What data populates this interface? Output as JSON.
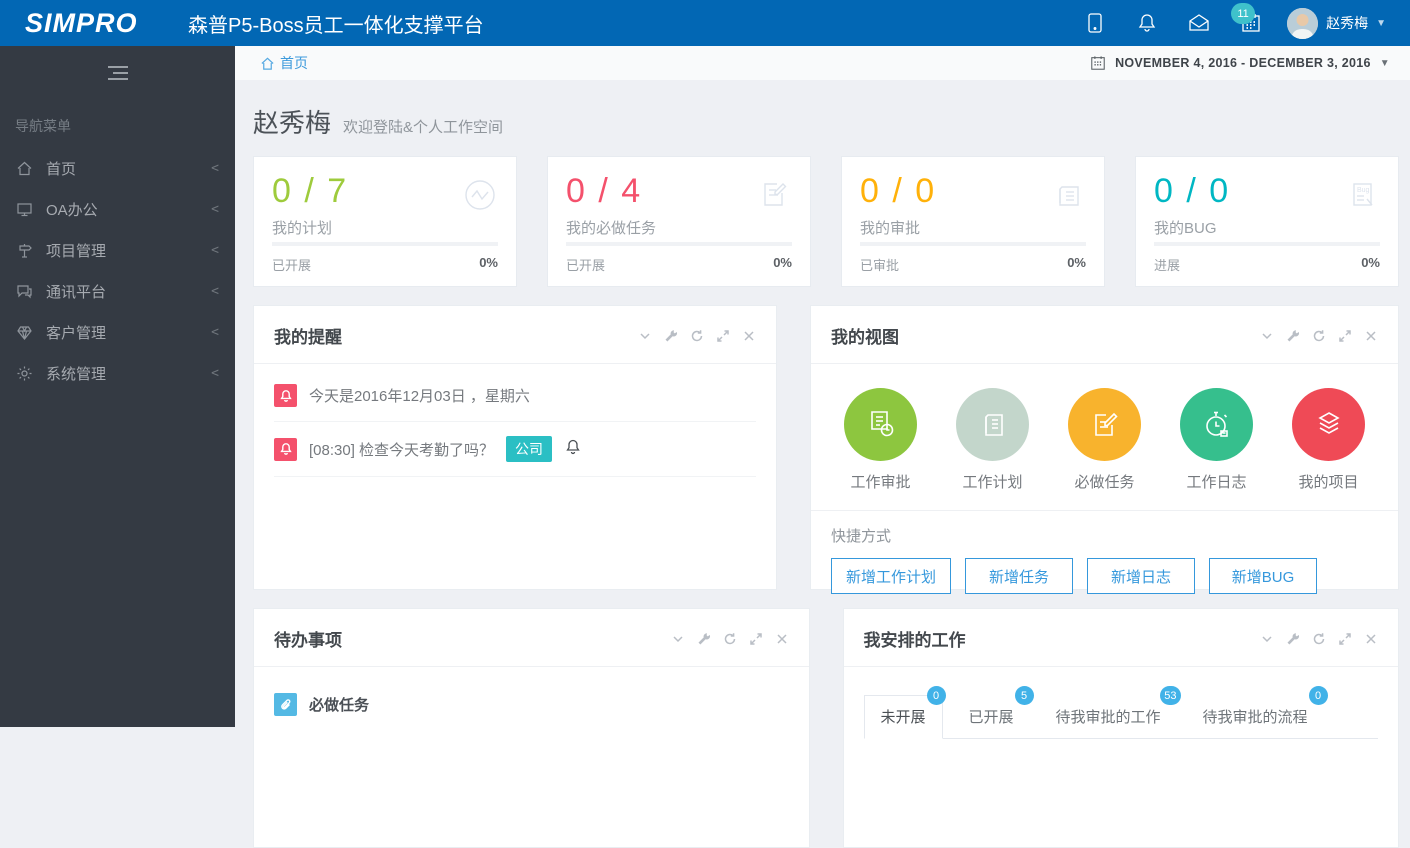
{
  "header": {
    "logo": "SIMPRO",
    "title": "森普P5-Boss员工一体化支撑平台",
    "calendar_badge": "11",
    "user_name": "赵秀梅"
  },
  "sidebar": {
    "section_label": "导航菜单",
    "items": [
      {
        "label": "首页",
        "icon": "home-icon"
      },
      {
        "label": "OA办公",
        "icon": "monitor-icon"
      },
      {
        "label": "项目管理",
        "icon": "signpost-icon"
      },
      {
        "label": "通讯平台",
        "icon": "chat-icon"
      },
      {
        "label": "客户管理",
        "icon": "gem-icon"
      },
      {
        "label": "系统管理",
        "icon": "gear-icon"
      }
    ]
  },
  "breadcrumb": {
    "home": "首页"
  },
  "daterange": {
    "value": "NOVEMBER 4, 2016 - DECEMBER 3, 2016"
  },
  "welcome": {
    "name": "赵秀梅",
    "subtitle": "欢迎登陆&个人工作空间"
  },
  "stats": [
    {
      "value": "0 / 7",
      "label": "我的计划",
      "footer_label": "已开展",
      "percent": "0%",
      "progress": 0,
      "color": "#9ecb3c",
      "icon": "pulse-circle-icon"
    },
    {
      "value": "0 / 4",
      "label": "我的必做任务",
      "footer_label": "已开展",
      "percent": "0%",
      "progress": 0,
      "color": "#f4516c",
      "icon": "edit-note-icon"
    },
    {
      "value": "0 / 0",
      "label": "我的审批",
      "footer_label": "已审批",
      "percent": "0%",
      "progress": 0,
      "color": "#ffb10a",
      "icon": "news-doc-icon"
    },
    {
      "value": "0 / 0",
      "label": "我的BUG",
      "footer_label": "进展",
      "percent": "0%",
      "progress": 0,
      "color": "#00b7c3",
      "icon": "bug-doc-icon"
    }
  ],
  "reminders_panel": {
    "title": "我的提醒",
    "items": [
      {
        "text": "今天是2016年12月03日 ，星期六",
        "badge": ""
      },
      {
        "text": "[08:30] 检查今天考勤了吗？",
        "badge": "公司"
      }
    ]
  },
  "views_panel": {
    "title": "我的视图",
    "items": [
      {
        "label": "工作审批",
        "color": "#8dc63f",
        "icon": "doc-clock-icon"
      },
      {
        "label": "工作计划",
        "color": "#c3d6cb",
        "icon": "doc-lines-icon"
      },
      {
        "label": "必做任务",
        "color": "#f8b32d",
        "icon": "edit-square-icon"
      },
      {
        "label": "工作日志",
        "color": "#36bf8d",
        "icon": "stopwatch-icon"
      },
      {
        "label": "我的项目",
        "color": "#ef4a56",
        "icon": "layers-icon"
      }
    ],
    "shortcuts_label": "快捷方式",
    "shortcuts": [
      {
        "label": "新增工作计划"
      },
      {
        "label": "新增任务"
      },
      {
        "label": "新增日志"
      },
      {
        "label": "新增BUG"
      }
    ]
  },
  "todo_panel": {
    "title": "待办事项",
    "items": [
      {
        "label": "必做任务"
      }
    ]
  },
  "work_panel": {
    "title": "我安排的工作",
    "tabs": [
      {
        "label": "未开展",
        "count": "0",
        "active": true
      },
      {
        "label": "已开展",
        "count": "5",
        "active": false
      },
      {
        "label": "待我审批的工作",
        "count": "53",
        "active": false
      },
      {
        "label": "待我审批的流程",
        "count": "0",
        "active": false
      }
    ]
  },
  "colors": {
    "header_bg": "#0267b4",
    "sidebar_bg": "#343a43",
    "content_bg": "#eef0f4",
    "accent_blue": "#3598dc",
    "badge_teal": "#2bbfc4",
    "badge_red": "#f4516c",
    "tab_badge_blue": "#41b2e8"
  }
}
